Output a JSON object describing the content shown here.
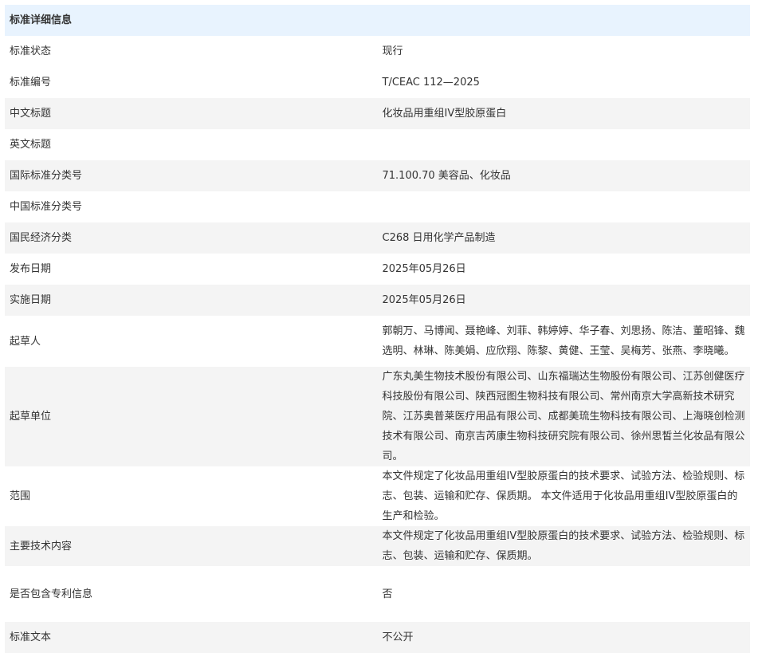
{
  "section_title": "标准详细信息",
  "rows": [
    {
      "label": "标准状态",
      "value": "现行"
    },
    {
      "label": "标准编号",
      "value": "T/CEAC 112—2025"
    },
    {
      "label": "中文标题",
      "value": "化妆品用重组IV型胶原蛋白"
    },
    {
      "label": "英文标题",
      "value": ""
    },
    {
      "label": "国际标准分类号",
      "value": "71.100.70 美容品、化妆品"
    },
    {
      "label": "中国标准分类号",
      "value": ""
    },
    {
      "label": "国民经济分类",
      "value": "C268 日用化学产品制造"
    },
    {
      "label": "发布日期",
      "value": "2025年05月26日"
    },
    {
      "label": "实施日期",
      "value": "2025年05月26日"
    },
    {
      "label": "起草人",
      "value": "郭朝万、马博闻、聂艳峰、刘菲、韩婷婷、华子春、刘思扬、陈洁、董昭锋、魏选明、林琳、陈美娟、应欣翔、陈黎、黄健、王莹、吴梅芳、张燕、李晓曦。"
    },
    {
      "label": "起草单位",
      "value": "广东丸美生物技术股份有限公司、山东福瑞达生物股份有限公司、江苏创健医疗科技股份有限公司、陕西冠图生物科技有限公司、常州南京大学高新技术研究院、江苏奥普莱医疗用品有限公司、成都美琉生物科技有限公司、上海晓创检测技术有限公司、南京吉芮康生物科技研究院有限公司、徐州思皙兰化妆品有限公司。"
    },
    {
      "label": "范围",
      "value": "本文件规定了化妆品用重组IV型胶原蛋白的技术要求、试验方法、检验规则、标志、包装、运输和贮存、保质期。 本文件适用于化妆品用重组IV型胶原蛋白的生产和检验。"
    },
    {
      "label": "主要技术内容",
      "value": "本文件规定了化妆品用重组IV型胶原蛋白的技术要求、试验方法、检验规则、标志、包装、运输和贮存、保质期。"
    },
    {
      "label": "是否包含专利信息",
      "value": "否"
    },
    {
      "label": "标准文本",
      "value": "不公开"
    }
  ]
}
